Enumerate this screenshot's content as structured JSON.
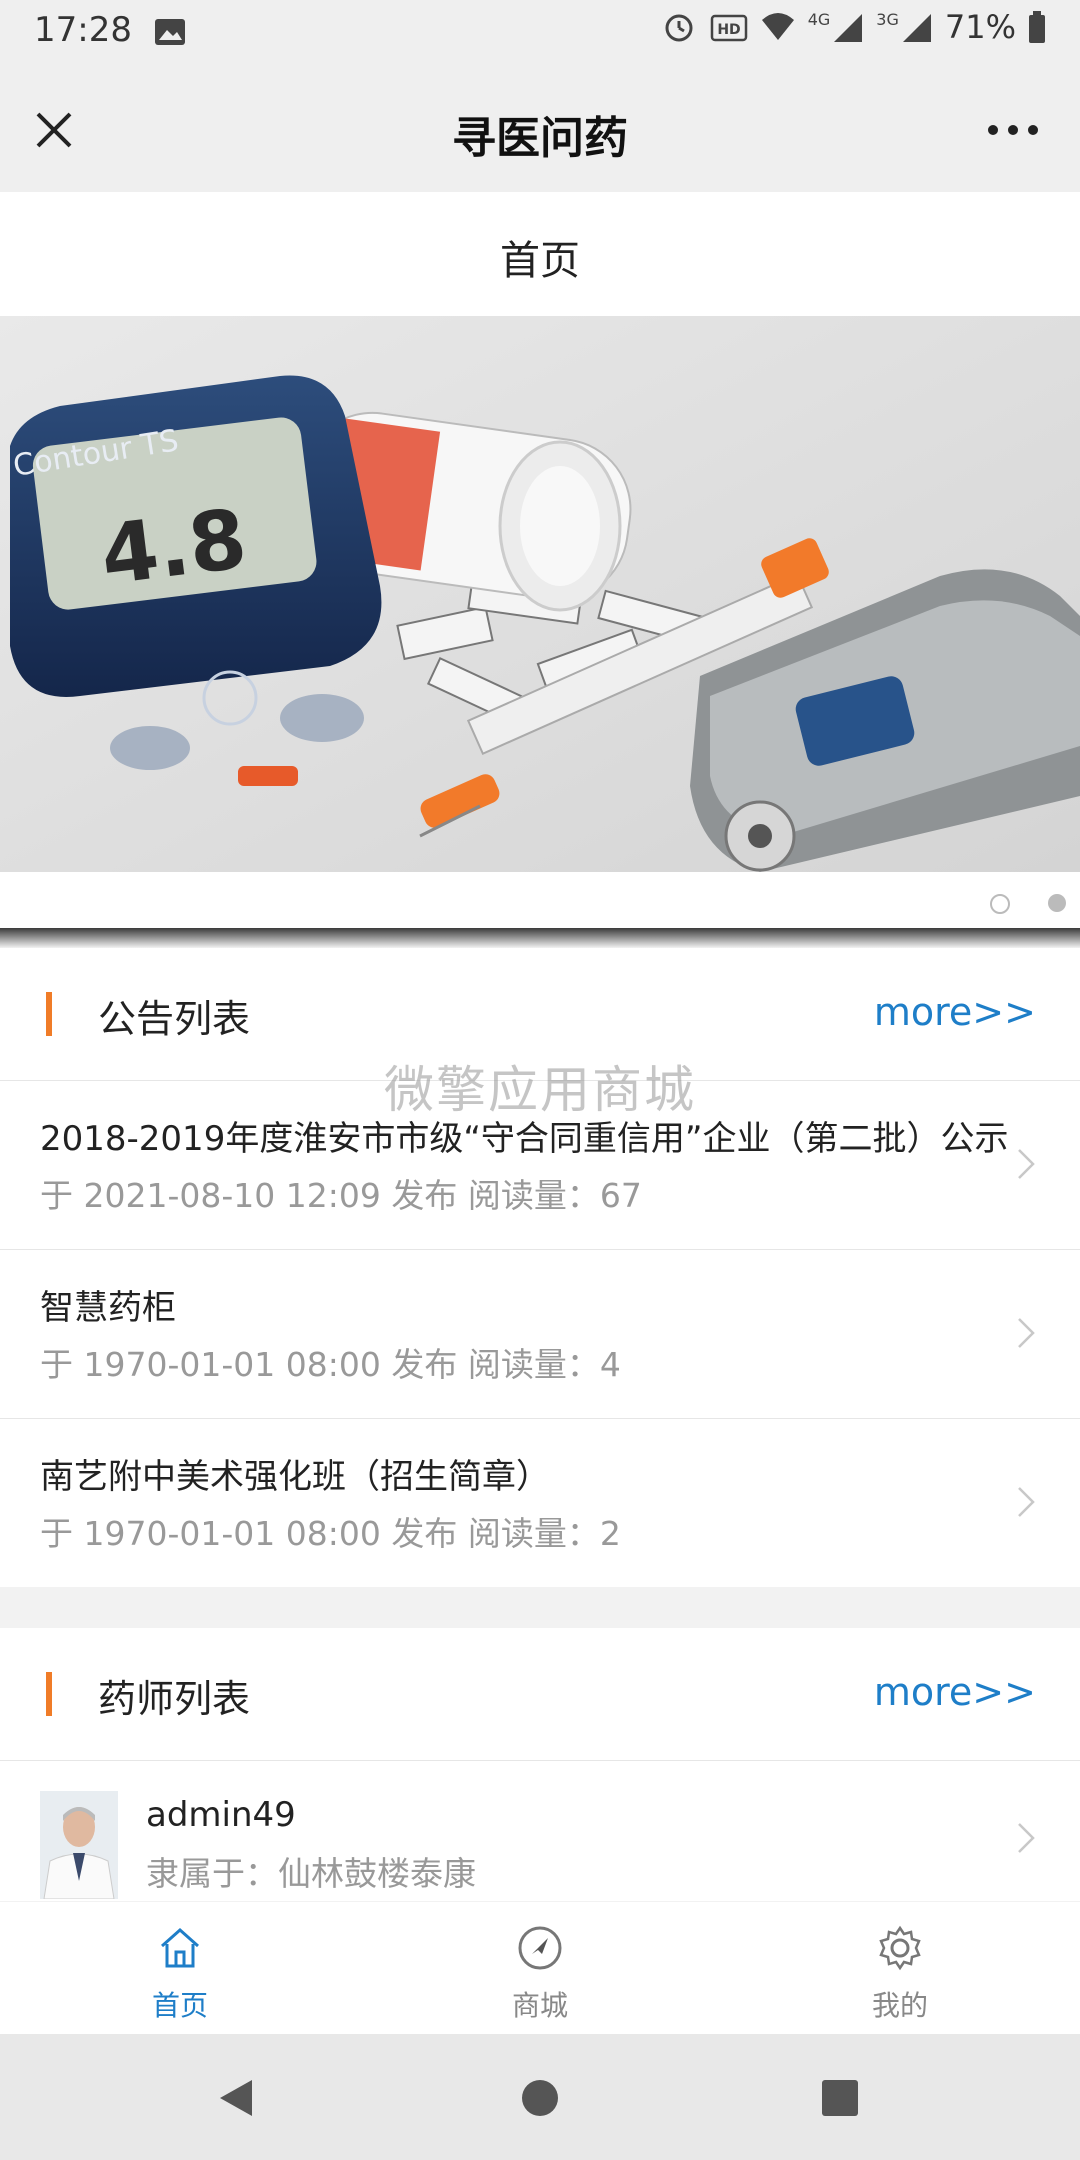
{
  "status_bar": {
    "time": "17:28",
    "network_4g": "4G",
    "network_3g": "3G",
    "hd_label": "HD",
    "battery": "71%",
    "icons": [
      "image-icon",
      "alarm-icon",
      "hd-icon",
      "wifi-icon",
      "signal-icon",
      "battery-icon"
    ]
  },
  "title_bar": {
    "title": "寻医问药"
  },
  "page_header": {
    "title": "首页"
  },
  "banner": {
    "meter_brand": "Contour TS",
    "meter_reading": "4.8",
    "dots": 2,
    "active_dot": 2
  },
  "watermark": "微擎应用商城",
  "announcements": {
    "title": "公告列表",
    "more": "more>>",
    "items": [
      {
        "title": "2018-2019年度淮安市市级“守合同重信用”企业（第二批）公示",
        "meta": "于 2021-08-10 12:09 发布 阅读量：67"
      },
      {
        "title": "智慧药柜",
        "meta": "于 1970-01-01 08:00 发布 阅读量：4"
      },
      {
        "title": "南艺附中美术强化班（招生简章）",
        "meta": "于 1970-01-01 08:00 发布 阅读量：2"
      }
    ]
  },
  "pharmacists": {
    "title": "药师列表",
    "more": "more>>",
    "items": [
      {
        "name": "admin49",
        "org": "隶属于：仙林鼓楼泰康"
      }
    ]
  },
  "tab_bar": {
    "tabs": [
      {
        "label": "首页",
        "icon": "home-icon",
        "active": true
      },
      {
        "label": "商城",
        "icon": "compass-icon",
        "active": false
      },
      {
        "label": "我的",
        "icon": "gear-icon",
        "active": false
      }
    ],
    "accent": "#1e7ec8"
  },
  "colors": {
    "accent_blue": "#1e7ec8",
    "section_marker": "#f07c28"
  }
}
